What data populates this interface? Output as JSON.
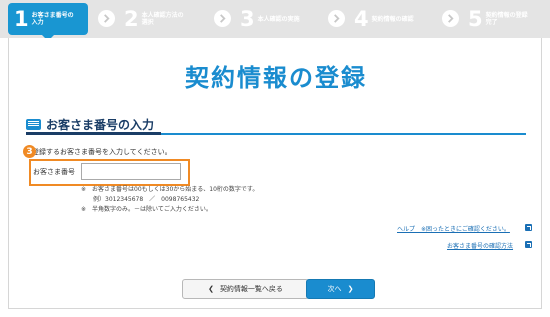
{
  "steps": [
    {
      "num": "1",
      "label_line1": "お客さま番号の",
      "label_line2": "入力"
    },
    {
      "num": "2",
      "label_line1": "本人確認方法の",
      "label_line2": "選択"
    },
    {
      "num": "3",
      "label_line1": "本人確認の実施",
      "label_line2": ""
    },
    {
      "num": "4",
      "label_line1": "契約情報の確認",
      "label_line2": ""
    },
    {
      "num": "5",
      "label_line1": "契約情報の登録",
      "label_line2": "完了"
    }
  ],
  "page": {
    "title": "契約情報の登録",
    "section_title": "お客さま番号の入力",
    "badge": "3",
    "instruction": "登録するお客さま番号を入力してください。",
    "field_label": "お客さま番号",
    "field_value": "",
    "notes": [
      "※　お客さま番号は00もしくは30から始まる、10桁の数字です。",
      "　　例）3012345678　／　0098765432",
      "※　半角数字のみ。－は除いてご入力ください。"
    ],
    "help_link": "ヘルプ　※困ったときにご確認ください。",
    "confirm_link": "お客さま番号の確認方法"
  },
  "buttons": {
    "back": "契約情報一覧へ戻る",
    "next": "次へ"
  },
  "colors": {
    "accent": "#1a8ccf",
    "active_step": "#1996d2",
    "highlight": "#f08a24"
  }
}
